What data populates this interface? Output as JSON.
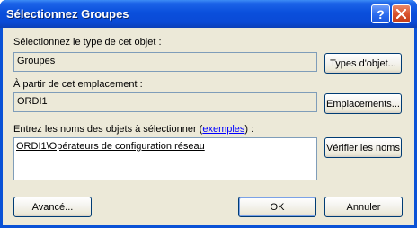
{
  "window": {
    "title": "Sélectionnez Groupes",
    "help_glyph": "?",
    "close_glyph": "✕"
  },
  "object_type": {
    "label": "Sélectionnez le type de cet objet :",
    "value": "Groupes",
    "button_label": "Types d'objet..."
  },
  "location": {
    "label": "À partir de cet emplacement :",
    "value": "ORDI1",
    "button_label": "Emplacements..."
  },
  "names": {
    "label_prefix": "Entrez les noms des objets à sélectionner (",
    "label_link": "exemples",
    "label_suffix": ") :",
    "value": "ORDI1\\Opérateurs de configuration réseau",
    "check_button_label": "Vérifier les noms"
  },
  "footer": {
    "advanced_label": "Avancé...",
    "ok_label": "OK",
    "cancel_label": "Annuler"
  },
  "colors": {
    "title_bar": "#0a4fdc",
    "client_bg": "#ece9d8",
    "link": "#0000ff"
  }
}
